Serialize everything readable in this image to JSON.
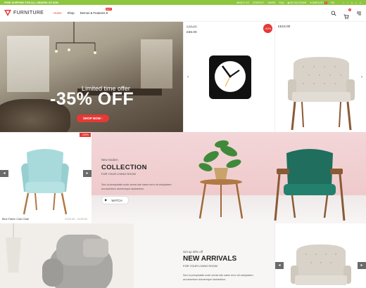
{
  "colors": {
    "accent": "#e53935",
    "topbar": "#8dc63f"
  },
  "topbar": {
    "promo": "FREE SHIPPING FOR ALL ORDERS OF $150",
    "links": [
      "ABOUT US",
      "CONTACT",
      "WORK",
      "FAQ"
    ],
    "account": "MY ACCOUNT",
    "wishlist": "WISHLIST",
    "wishlist_count": "0",
    "language": "EN"
  },
  "header": {
    "logo": "FURNITURE",
    "nav": [
      {
        "label": "Home",
        "active": true
      },
      {
        "label": "Shop"
      },
      {
        "label": "Demos & Features",
        "badge": "HOT"
      }
    ],
    "cart_count": "0"
  },
  "hero": {
    "kicker": "Limited time offer",
    "headline": "-35% OFF",
    "button": "SHOP NOW"
  },
  "products_top": [
    {
      "old_price": "£79.00",
      "price": "£56.00",
      "discount": "-30%"
    },
    {
      "price": "£519.00"
    }
  ],
  "featured": {
    "tag": "-100%",
    "name": "Blue Fabric Club Chair",
    "price_range": "£129.00 – £199.00"
  },
  "collection": {
    "kicker": "New modern",
    "title": "COLLECTION",
    "subtitle": "FOR YOUR LIVING ROOM",
    "body": "Sed ut perspiciatis unde omnis iste natus error sit voluptatem accusantium doloremque laudantium.",
    "button": "WATCH"
  },
  "arrivals": {
    "kicker": "Get up 30% off",
    "title": "NEW ARRIVALS",
    "subtitle": "FOR YOUR LIVING ROOM",
    "body": "Sed ut perspiciatis unde omnis iste natus error sit voluptatem accusantium doloremque laudantium."
  }
}
